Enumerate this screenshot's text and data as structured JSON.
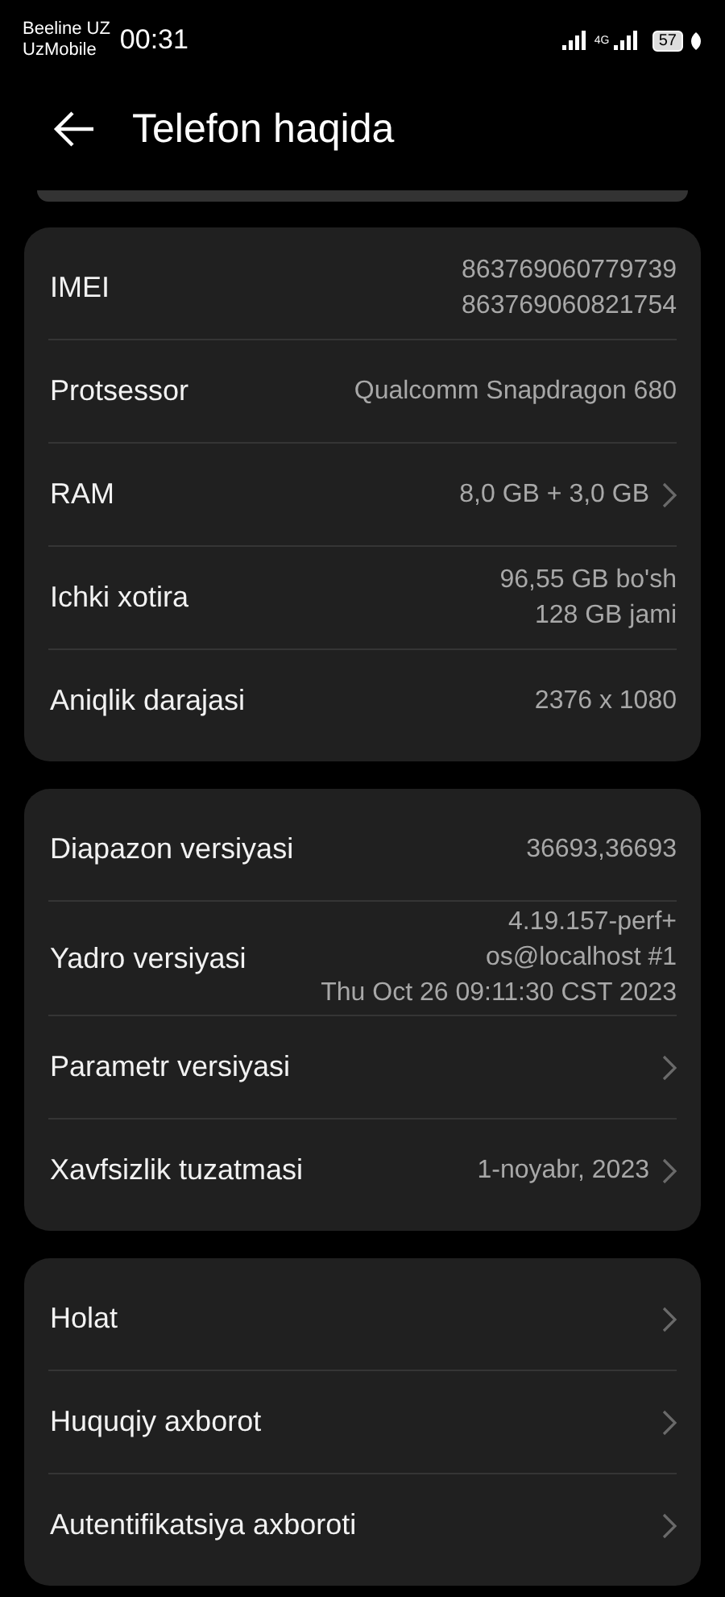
{
  "status_bar": {
    "carriers": [
      "Beeline UZ",
      "UzMobile"
    ],
    "time": "00:31",
    "network": "4G",
    "battery": "57"
  },
  "header": {
    "title": "Telefon haqida"
  },
  "cards": [
    {
      "rows": [
        {
          "label": "IMEI",
          "values": [
            "863769060779739",
            "863769060821754"
          ],
          "arrow": false
        },
        {
          "label": "Protsessor",
          "values": [
            "Qualcomm Snapdragon 680"
          ],
          "arrow": false
        },
        {
          "label": "RAM",
          "values": [
            "8,0 GB + 3,0 GB"
          ],
          "arrow": true
        },
        {
          "label": "Ichki xotira",
          "values": [
            "96,55  GB bo'sh",
            "128  GB jami"
          ],
          "arrow": false
        },
        {
          "label": "Aniqlik darajasi",
          "values": [
            "2376 x 1080"
          ],
          "arrow": false
        }
      ]
    },
    {
      "rows": [
        {
          "label": "Diapazon versiyasi",
          "values": [
            "36693,36693"
          ],
          "arrow": false
        },
        {
          "label": "Yadro versiyasi",
          "values": [
            "4.19.157-perf+",
            "os@localhost #1",
            "Thu Oct 26 09:11:30 CST 2023"
          ],
          "arrow": false
        },
        {
          "label": "Parametr versiyasi",
          "values": [],
          "arrow": true
        },
        {
          "label": "Xavfsizlik tuzatmasi",
          "values": [
            "1-noyabr, 2023"
          ],
          "arrow": true
        }
      ]
    },
    {
      "rows": [
        {
          "label": "Holat",
          "values": [],
          "arrow": true
        },
        {
          "label": "Huquqiy axborot",
          "values": [],
          "arrow": true
        },
        {
          "label": "Autentifikatsiya axboroti",
          "values": [],
          "arrow": true
        }
      ]
    }
  ]
}
